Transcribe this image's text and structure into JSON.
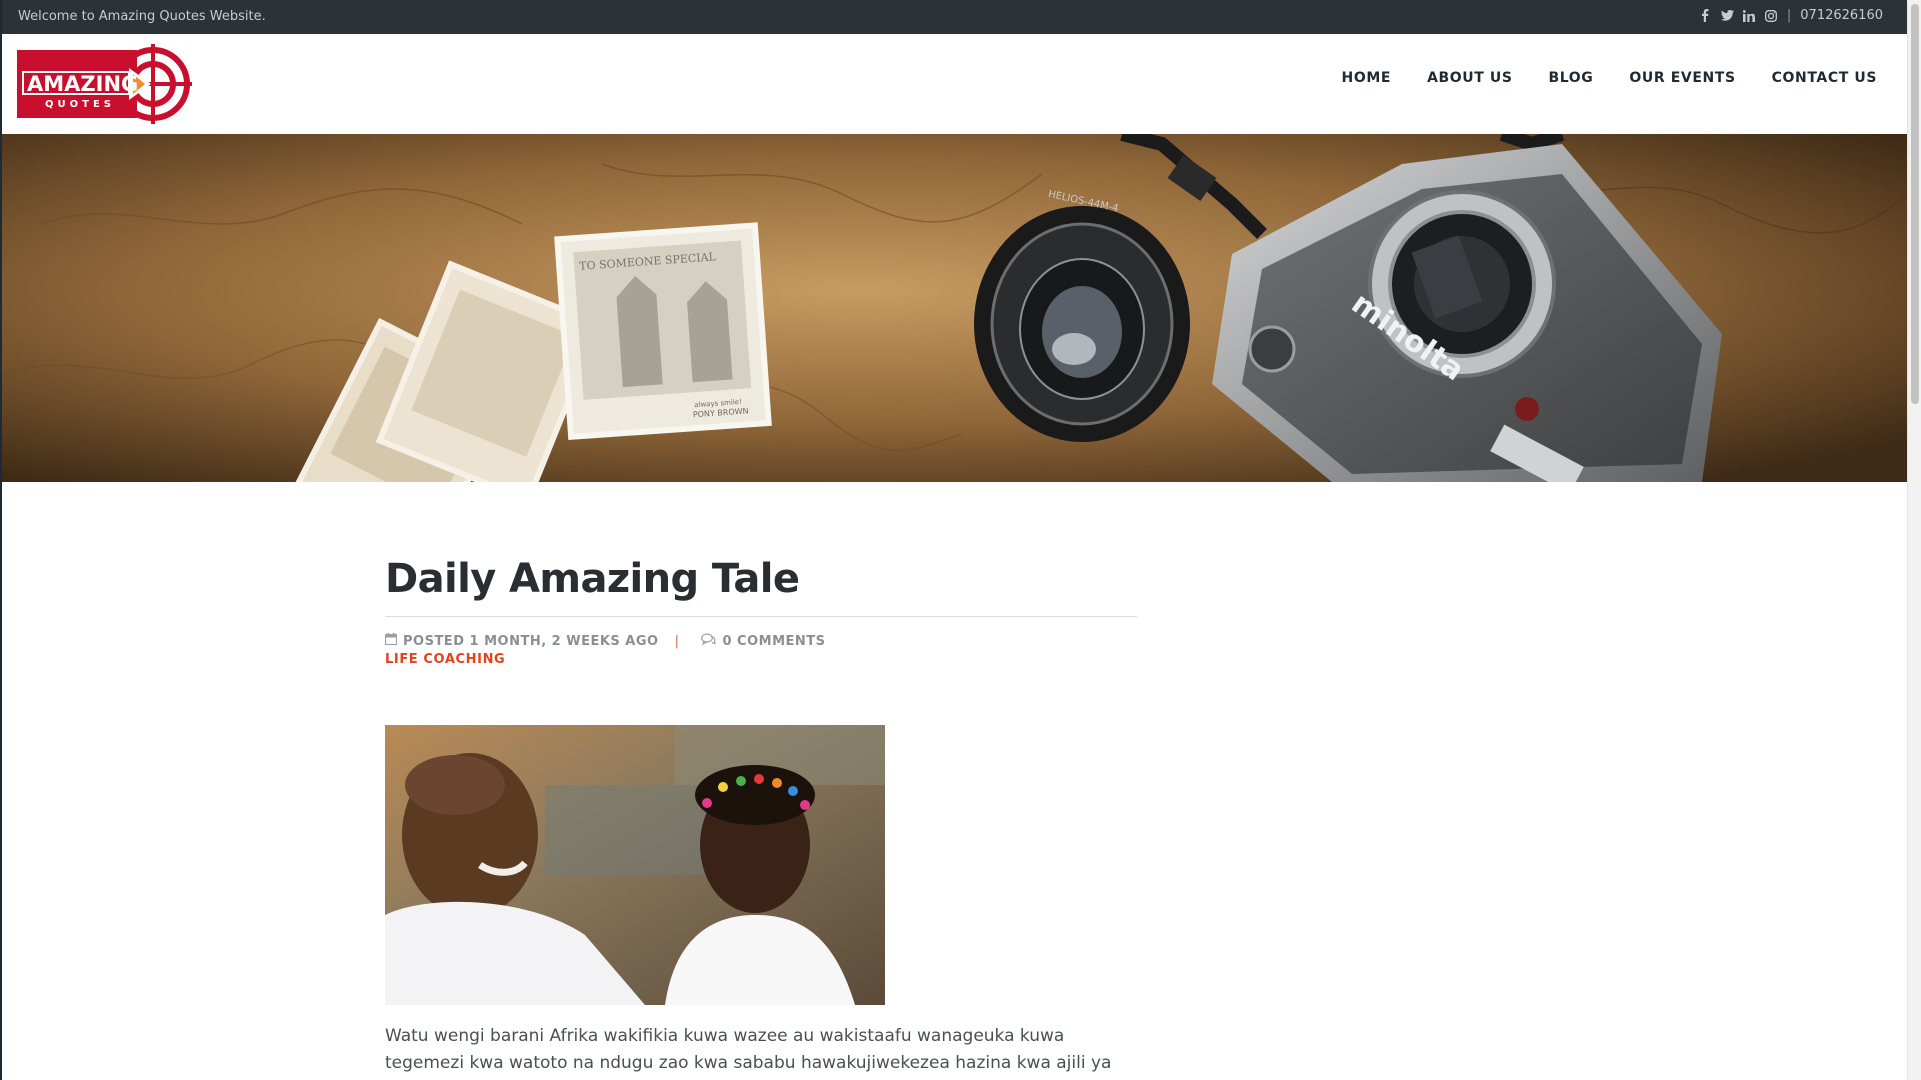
{
  "topbar": {
    "welcome": "Welcome to Amazing Quotes Website.",
    "social_icons": [
      "facebook-icon",
      "twitter-icon",
      "linkedin-icon",
      "instagram-icon"
    ],
    "separator": "|",
    "phone": "0712626160"
  },
  "logo": {
    "line1": "AMAZING",
    "line2": "QUOTES",
    "brand_color": "#c8102e"
  },
  "nav": {
    "items": [
      {
        "label": "HOME"
      },
      {
        "label": "ABOUT US"
      },
      {
        "label": "BLOG"
      },
      {
        "label": "OUR EVENTS"
      },
      {
        "label": "CONTACT US"
      }
    ]
  },
  "banner": {
    "postcard_text_1": "TO SOMEONE SPECIAL",
    "postcard_text_2": "always smile!",
    "postcard_text_3": "PONY BROWN",
    "lens_text": "HELIOS-44M-4",
    "camera_brand": "minolta"
  },
  "post": {
    "title": "Daily Amazing Tale",
    "posted": "POSTED 1 MONTH, 2 WEEKS AGO",
    "meta_separator": "|",
    "comments": "0 COMMENTS",
    "category": "LIFE COACHING",
    "body": "Watu wengi barani Afrika wakifikia kuwa wazee au wakistaafu wanageuka kuwa tegemezi kwa watoto na ndugu zao kwa sababu hawakujiwekezea hazina kwa ajili ya ubaadaye wao."
  },
  "colors": {
    "topbar_bg": "#2c3338",
    "accent": "#e3421b",
    "heading": "#2a2e32"
  }
}
